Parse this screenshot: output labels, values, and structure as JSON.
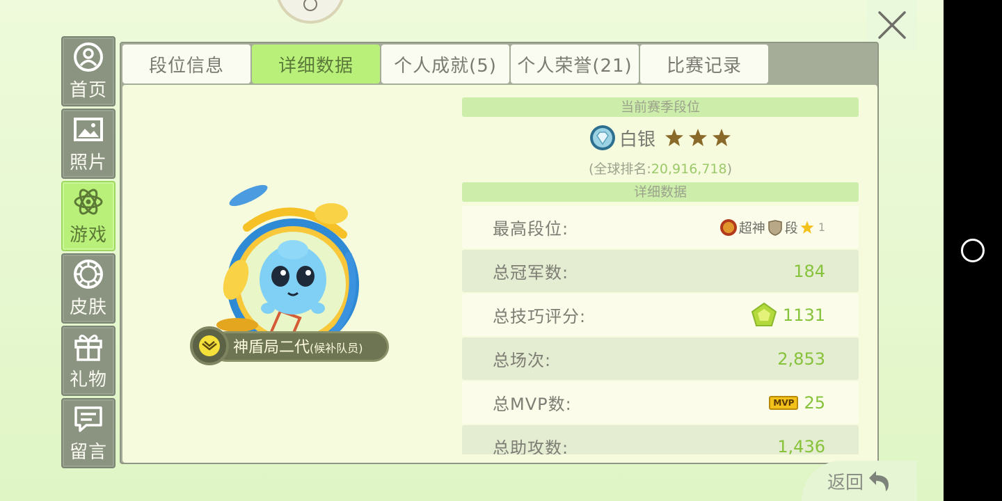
{
  "sidebar": {
    "items": [
      {
        "label": "首页",
        "icon": "user-icon",
        "active": false
      },
      {
        "label": "照片",
        "icon": "image-icon",
        "active": false
      },
      {
        "label": "游戏",
        "icon": "atom-icon",
        "active": true
      },
      {
        "label": "皮肤",
        "icon": "diamond-ring-icon",
        "active": false
      },
      {
        "label": "礼物",
        "icon": "gift-icon",
        "active": false
      },
      {
        "label": "留言",
        "icon": "message-icon",
        "active": false
      }
    ]
  },
  "tabs": [
    {
      "label": "段位信息",
      "active": false
    },
    {
      "label": "详细数据",
      "active": true
    },
    {
      "label": "个人成就(5)",
      "active": false
    },
    {
      "label": "个人荣誉(21)",
      "active": false
    },
    {
      "label": "比赛记录",
      "active": false
    }
  ],
  "team": {
    "name": "神盾局二代",
    "role": "(候补队员)"
  },
  "season": {
    "section_title": "当前赛季段位",
    "rank_name": "白银",
    "stars": 3,
    "global_rank_label": "(全球排名:",
    "global_rank_value": "20,916,718",
    "global_rank_suffix": ")"
  },
  "details": {
    "section_title": "详细数据",
    "rows": [
      {
        "label": "最高段位:",
        "tier_name": "超神",
        "tier_sub": "段",
        "tier_level": "1"
      },
      {
        "label": "总冠军数:",
        "value": "184"
      },
      {
        "label": "总技巧评分:",
        "value": "1131"
      },
      {
        "label": "总场次:",
        "value": "2,853"
      },
      {
        "label": "总MVP数:",
        "value": "25",
        "tag": "MVP"
      },
      {
        "label": "总助攻数:",
        "value": "1,436"
      }
    ]
  },
  "back": {
    "label": "返回"
  },
  "colors": {
    "accent_green": "#b9f07a",
    "value_green": "#86c23a",
    "sidebar_gray": "#8a9480"
  }
}
